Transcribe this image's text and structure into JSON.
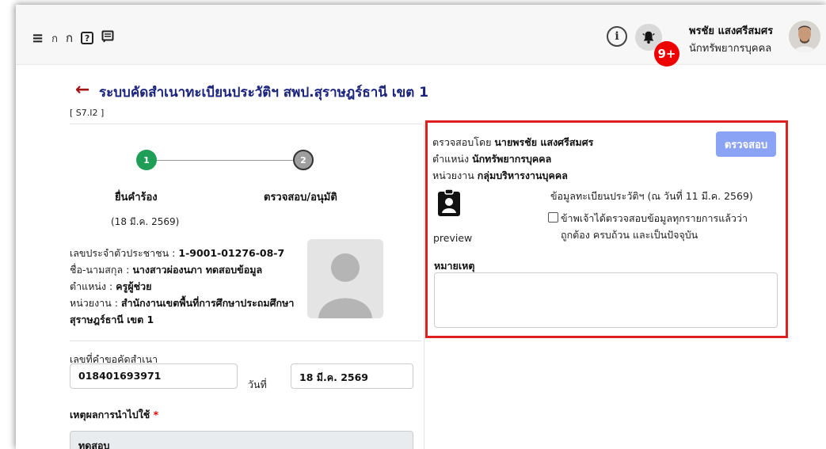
{
  "topbar": {
    "menu_icon": "hamburger-icon",
    "font_small": "ก",
    "font_large": "ก",
    "help_glyph": "?",
    "notification_count": "9+",
    "user_name": "พรชัย แสงศรีสมศร",
    "user_role": "นักทรัพยากรบุคคล"
  },
  "page": {
    "title": "ระบบคัดสำเนาทะเบียนประวัติฯ สพป.สุราษฎร์ธานี เขต 1",
    "code": "[ S7.I2 ]"
  },
  "stepper": {
    "steps": [
      {
        "number": "1",
        "label": "ยื่นคำร้อง",
        "date": "(18 มี.ค. 2569)",
        "status": "done"
      },
      {
        "number": "2",
        "label": "ตรวจสอบ/อนุมัติ",
        "status": "pending"
      }
    ]
  },
  "person": {
    "id_label": "เลขประจำตัวประชาชน : ",
    "id_value": "1-9001-01276-08-7",
    "name_label": "ชื่อ-นามสกุล : ",
    "name_value": "นางสาวผ่องนภา ทดสอบข้อมูล",
    "position_label": "ตำแหน่ง : ",
    "position_value": "ครูผู้ช่วย",
    "unit_label": "หน่วยงาน : ",
    "unit_value": "สำนักงานเขตพื้นที่การศึกษาประถมศึกษา สุราษฎร์ธานี เขต 1"
  },
  "request": {
    "number_label": "เลขที่คำขอคัดสำเนา",
    "number_value": "018401693971",
    "date_label": "วันที่",
    "date_value": "18 มี.ค. 2569",
    "reason_label": "เหตุผลการนำไปใช้",
    "required_mark": "*",
    "reason_value": "ทดสอบ"
  },
  "review": {
    "verified_by_label": "ตรวจสอบโดย ",
    "verified_by_value": "นายพรชัย แสงศรีสมศร",
    "position_label": "ตำแหน่ง ",
    "position_value": "นักทรัพยากรบุคคล",
    "unit_label": "หน่วยงาน ",
    "unit_value": "กลุ่มบริหารงานบุคคล",
    "verify_button": "ตรวจสอบ",
    "document_icon": "clipboard-user-icon",
    "preview_label": "preview",
    "registry_info": "ข้อมูลทะเบียนประวัติฯ (ณ วันที่ 11 มี.ค. 2569)",
    "confirm_line1": "ข้าพเจ้าได้ตรวจสอบข้อมูลทุกรายการแล้วว่า",
    "confirm_line2": "ถูกต้อง ครบถ้วน และเป็นปัจจุบัน",
    "note_label": "หมายเหตุ",
    "note_value": ""
  },
  "colors": {
    "accent_blue": "#1a237e",
    "back_arrow": "#a31616",
    "step_done": "#1e9e57",
    "step_pending": "#9e9e9e",
    "button": "#8aa3f5",
    "highlight_border": "#e02020",
    "badge": "#ee0000"
  }
}
